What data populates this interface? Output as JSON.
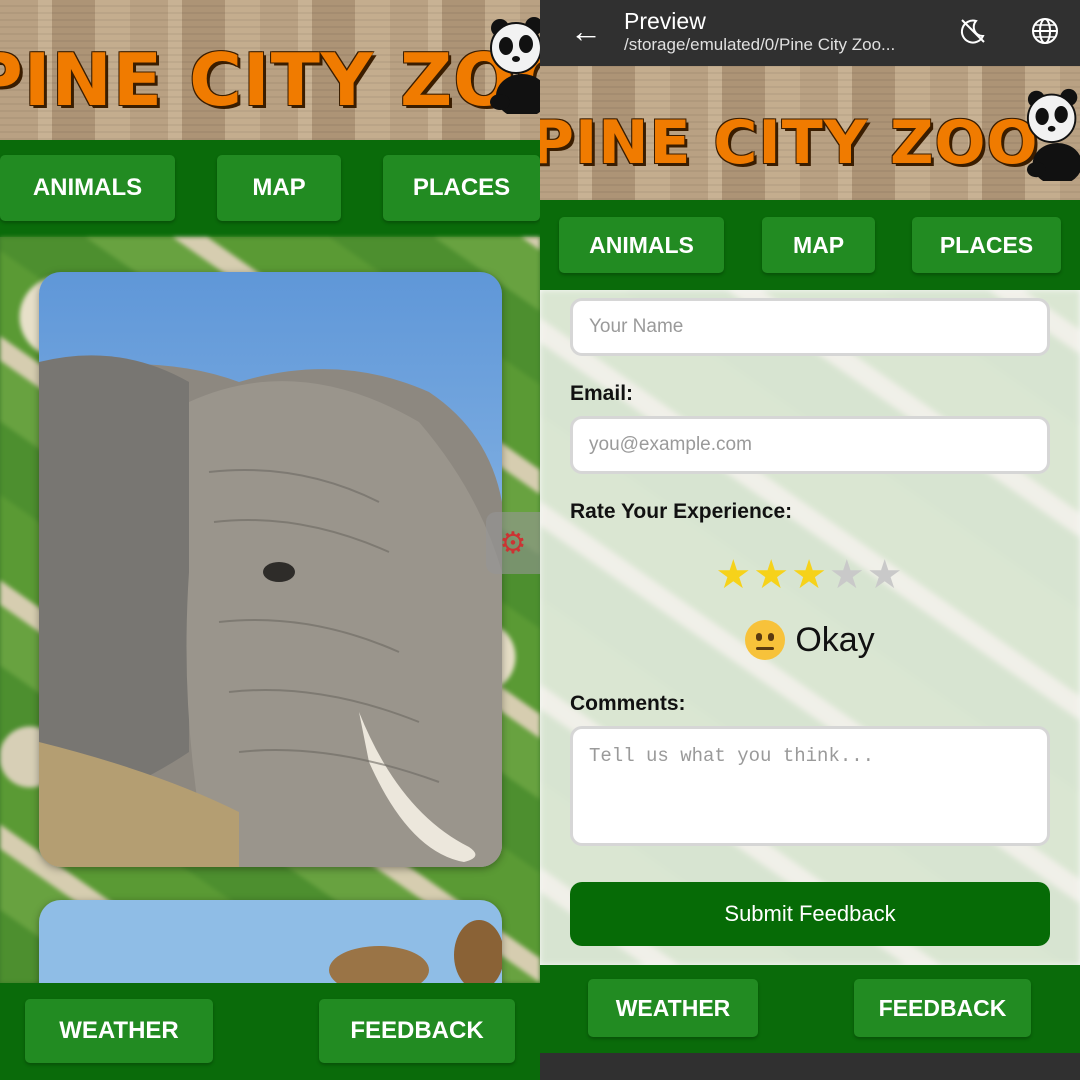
{
  "left": {
    "brand": "PINE CITY ZOO",
    "nav": [
      "ANIMALS",
      "MAP",
      "PLACES"
    ],
    "bottom_nav": [
      "WEATHER",
      "FEEDBACK"
    ]
  },
  "right": {
    "appbar": {
      "title": "Preview",
      "subtitle": "/storage/emulated/0/Pine City Zoo..."
    },
    "brand": "PINE CITY ZOO",
    "nav": [
      "ANIMALS",
      "MAP",
      "PLACES"
    ],
    "form": {
      "name_placeholder": "Your Name",
      "email_label": "Email:",
      "email_placeholder": "you@example.com",
      "rate_label": "Rate Your Experience:",
      "rating_value": 3,
      "rating_max": 5,
      "rating_text": "Okay",
      "comments_label": "Comments:",
      "comments_placeholder": "Tell us what you think...",
      "submit_label": "Submit Feedback"
    },
    "bottom_nav": [
      "WEATHER",
      "FEEDBACK"
    ]
  },
  "colors": {
    "nav_green": "#0a6b0a",
    "button_green": "#228b22",
    "title_orange": "#f07b00",
    "star_gold": "#f6d21a"
  },
  "icons": [
    "back-arrow-icon",
    "theme-toggle-icon",
    "globe-icon",
    "settings-gear-icon",
    "panda-logo"
  ]
}
